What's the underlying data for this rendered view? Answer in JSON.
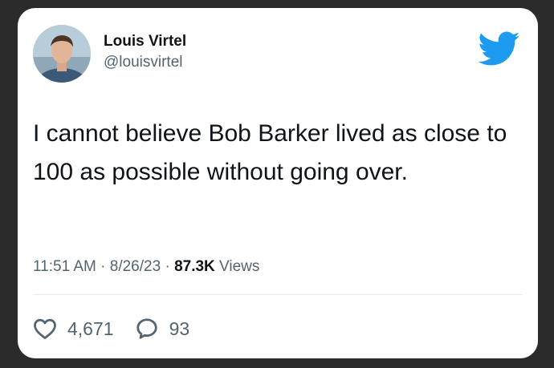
{
  "tweet": {
    "user": {
      "name": "Louis Virtel",
      "handle": "@louisvirtel"
    },
    "text": "I cannot believe Bob Barker lived as close to 100 as possible without going over.",
    "meta": {
      "time": "11:51 AM",
      "date": "8/26/23",
      "views_count": "87.3K",
      "views_label": "Views",
      "separator": "·"
    },
    "stats": {
      "likes": "4,671",
      "replies": "93"
    }
  },
  "colors": {
    "twitter_blue": "#1d9bf0",
    "text_primary": "#0f1419",
    "text_secondary": "#536471",
    "divider": "#e6ecf0"
  },
  "icons": {
    "brand": "twitter-bird-icon",
    "like": "heart-icon",
    "reply": "speech-bubble-icon"
  }
}
